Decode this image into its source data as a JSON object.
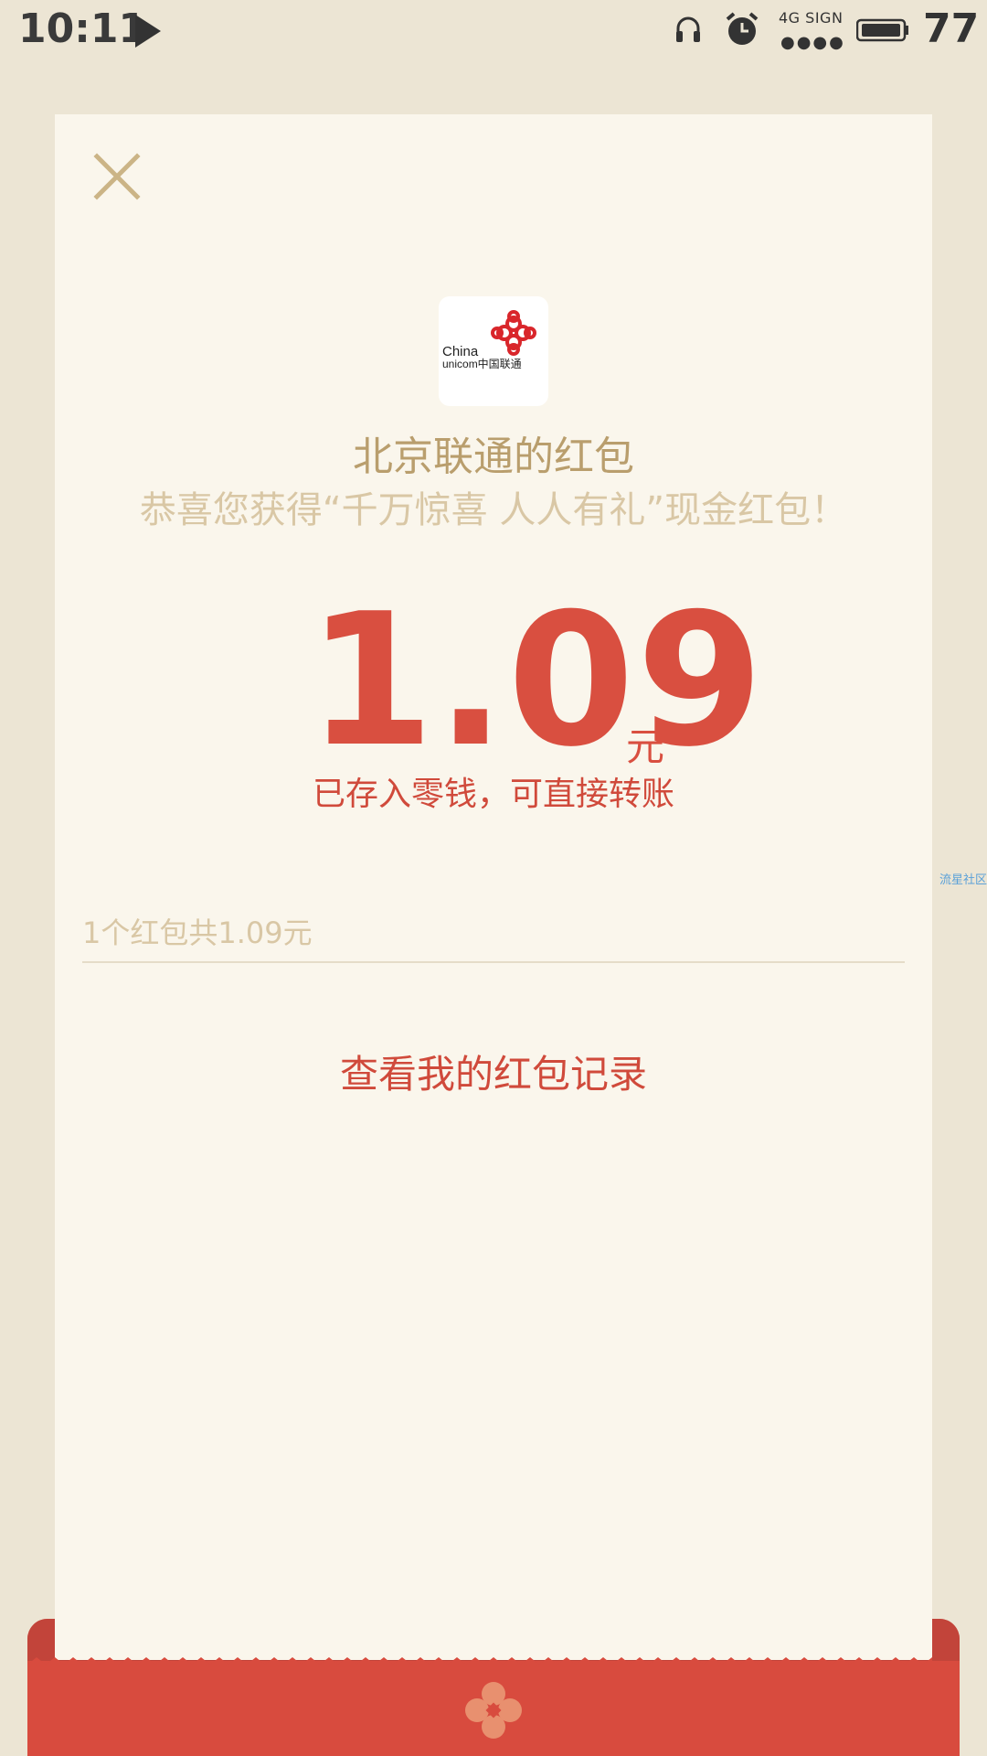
{
  "status_bar": {
    "time": "10:11",
    "signal_label": "4G SIGN",
    "signal_dots": "●●●●",
    "battery_level": "77",
    "icons": [
      "play-icon",
      "headphone-icon",
      "alarm-icon",
      "signal-icon",
      "battery-icon"
    ]
  },
  "card": {
    "logo_lines": [
      "China",
      "unicom中国联通"
    ],
    "sender_title": "北京联通的红包",
    "greeting": "恭喜您获得“千万惊喜 人人有礼”现金红包！",
    "amount": "1.09",
    "amount_unit": "元",
    "deposit_note": "已存入零钱，可直接转账",
    "summary": "1个红包共1.09元",
    "record_link": "查看我的红包记录"
  },
  "watermark": "流星社区",
  "colors": {
    "background": "#ECE5D4",
    "card": "#FAF6EC",
    "accent_red": "#D94F40",
    "gold_text": "#B99E6D",
    "muted_gold": "#D9C7A5",
    "envelope_red": "#D84B3E"
  }
}
